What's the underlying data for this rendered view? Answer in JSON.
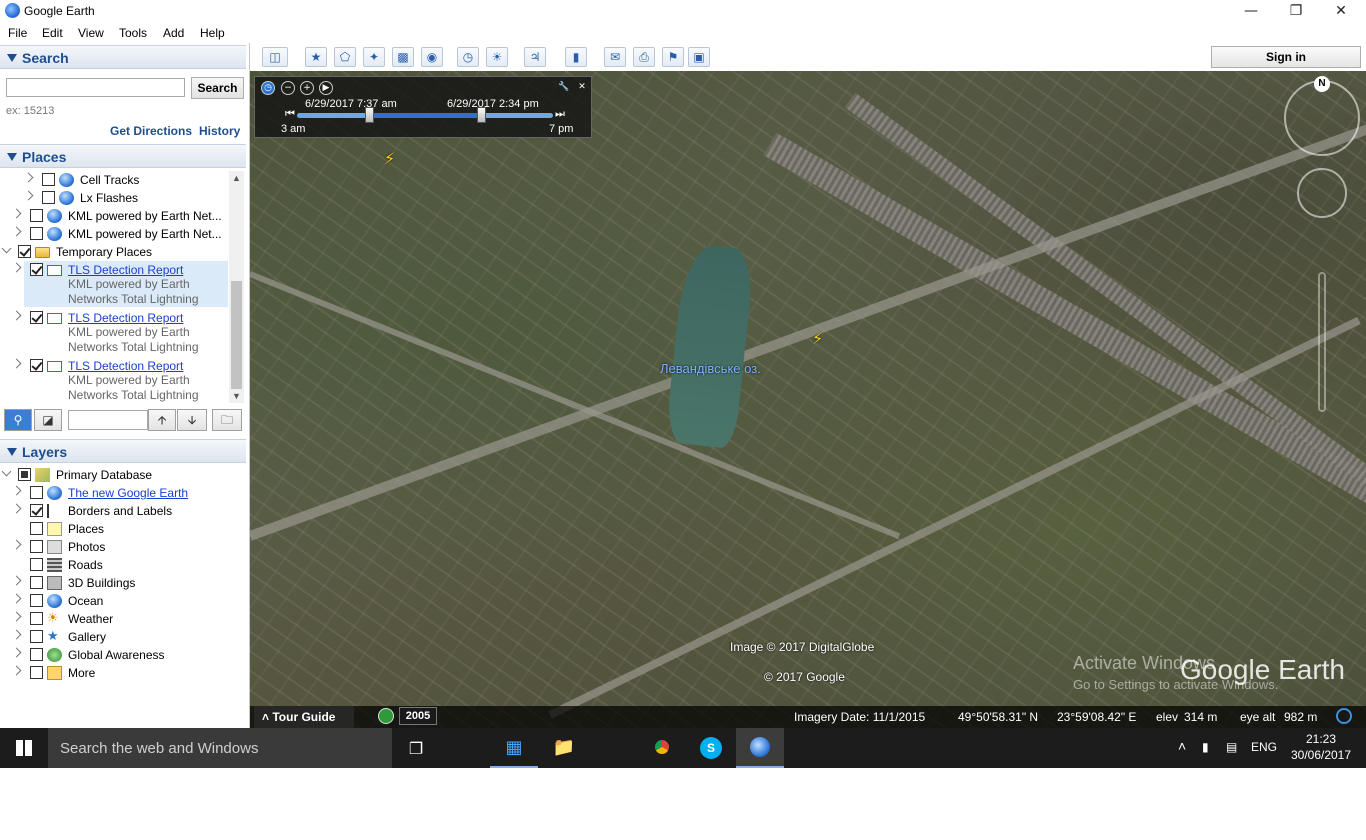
{
  "window": {
    "title": "Google Earth"
  },
  "menu": [
    "File",
    "Edit",
    "View",
    "Tools",
    "Add",
    "Help"
  ],
  "search": {
    "header": "Search",
    "button": "Search",
    "input_value": "",
    "hint": "ex: 15213",
    "get_directions": "Get Directions",
    "history": "History"
  },
  "places": {
    "header": "Places",
    "items": [
      {
        "label": "Cell Tracks"
      },
      {
        "label": "Lx Flashes"
      },
      {
        "label": "KML powered by Earth Net..."
      },
      {
        "label": "KML powered by Earth Net..."
      },
      {
        "label": "Temporary Places"
      },
      {
        "label": "TLS Detection Report",
        "sub1": "KML powered by Earth",
        "sub2": "Networks Total Lightning"
      },
      {
        "label": "TLS Detection Report",
        "sub1": "KML powered by Earth",
        "sub2": "Networks Total Lightning"
      },
      {
        "label": "TLS Detection Report",
        "sub1": "KML powered by Earth",
        "sub2": "Networks Total Lightning"
      }
    ]
  },
  "layers": {
    "header": "Layers",
    "items": [
      {
        "label": "Primary Database"
      },
      {
        "label": "The new Google Earth"
      },
      {
        "label": "Borders and Labels"
      },
      {
        "label": "Places"
      },
      {
        "label": "Photos"
      },
      {
        "label": "Roads"
      },
      {
        "label": "3D Buildings"
      },
      {
        "label": "Ocean"
      },
      {
        "label": "Weather"
      },
      {
        "label": "Gallery"
      },
      {
        "label": "Global Awareness"
      },
      {
        "label": "More"
      }
    ]
  },
  "toolbar": {
    "sign_in": "Sign in"
  },
  "time_slider": {
    "start_label": "6/29/2017   7:37 am",
    "end_label": "6/29/2017   2:34 pm",
    "min_label": "3 am",
    "max_label": "7 pm",
    "start_pos": 0.28,
    "end_pos": 0.72
  },
  "map": {
    "place_label": "Левандівське оз.",
    "credit1": "Image © 2017 DigitalGlobe",
    "credit2": "© 2017 Google",
    "compass": "N",
    "logo": "Google Earth",
    "activate_title": "Activate Windows",
    "activate_sub": "Go to Settings to activate Windows."
  },
  "statusbar": {
    "tour_guide": "Tour Guide",
    "year": "2005",
    "imagery_date": "Imagery Date: 11/1/2015",
    "lat": "49°50'58.31\" N",
    "lon": "23°59'08.42\" E",
    "elev_label": "elev",
    "elev": "314 m",
    "eye_alt_label": "eye alt",
    "eye_alt": "982 m"
  },
  "taskbar": {
    "search": "Search the web and Windows",
    "lang": "ENG",
    "time": "21:23",
    "date": "30/06/2017"
  }
}
